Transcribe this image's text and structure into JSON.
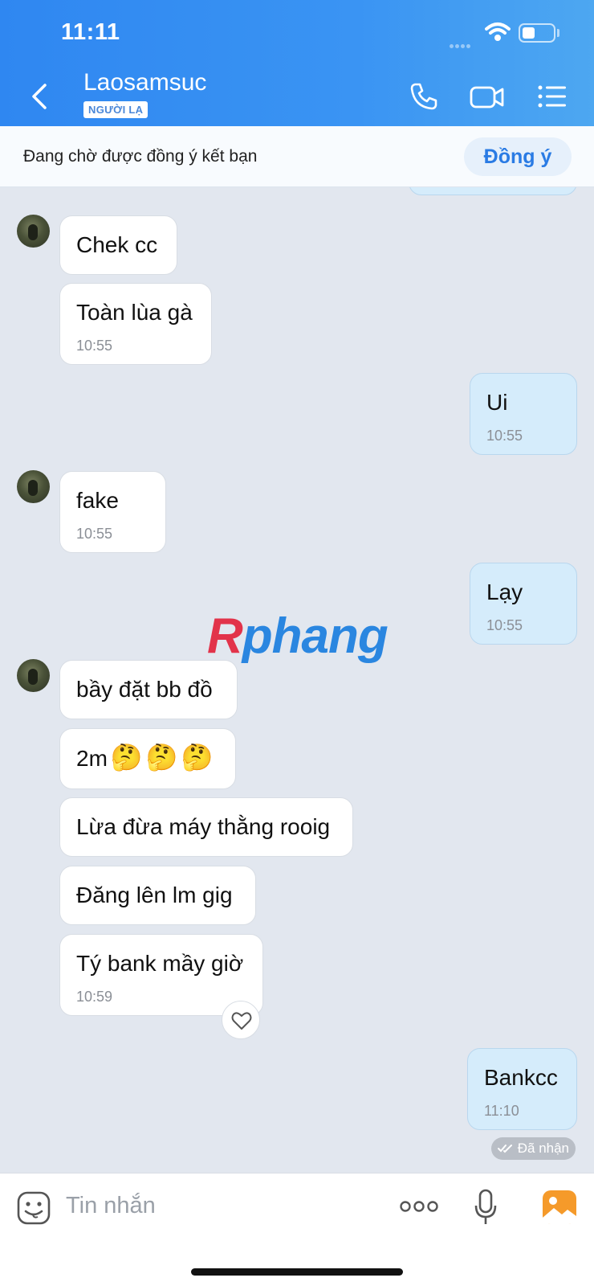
{
  "status_bar": {
    "time": "11:11"
  },
  "header": {
    "title": "Laosamsuc",
    "badge": "NGƯỜI LẠ"
  },
  "pending": {
    "text": "Đang chờ được đồng ý kết bạn",
    "accept_label": "Đồng ý"
  },
  "messages": [
    {
      "dir": "in",
      "text": "Chek cc"
    },
    {
      "dir": "in",
      "text": "Toàn lùa gà",
      "time": "10:55"
    },
    {
      "dir": "out",
      "text": "Ui",
      "time": "10:55"
    },
    {
      "dir": "in",
      "text": "fake",
      "time": "10:55"
    },
    {
      "dir": "out",
      "text": "Lạy",
      "time": "10:55"
    },
    {
      "dir": "in",
      "text": "bầy đặt bb đồ"
    },
    {
      "dir": "in",
      "text": "2m"
    },
    {
      "dir": "in",
      "text": "Lừa đừa máy thằng rooig"
    },
    {
      "dir": "in",
      "text": "Đăng lên lm gig"
    },
    {
      "dir": "in",
      "text": "Tý bank mầy giờ",
      "time": "10:59"
    },
    {
      "dir": "out",
      "text": "Bankcc",
      "time": "11:10"
    }
  ],
  "delivery_status": "Đã nhận",
  "watermark": {
    "first": "R",
    "rest": "phang"
  },
  "input": {
    "placeholder": "Tin nhắn"
  },
  "colors": {
    "header_start": "#2f87f1",
    "header_end": "#4da7f1",
    "accent": "#2a7be4",
    "incoming_bubble": "#ffffff",
    "outgoing_bubble": "#d5ecfb"
  },
  "icons": [
    "back-icon",
    "phone-icon",
    "video-call-icon",
    "menu-list-icon",
    "sticker-icon",
    "more-icon",
    "microphone-icon",
    "image-icon",
    "heart-icon",
    "double-check-icon"
  ]
}
